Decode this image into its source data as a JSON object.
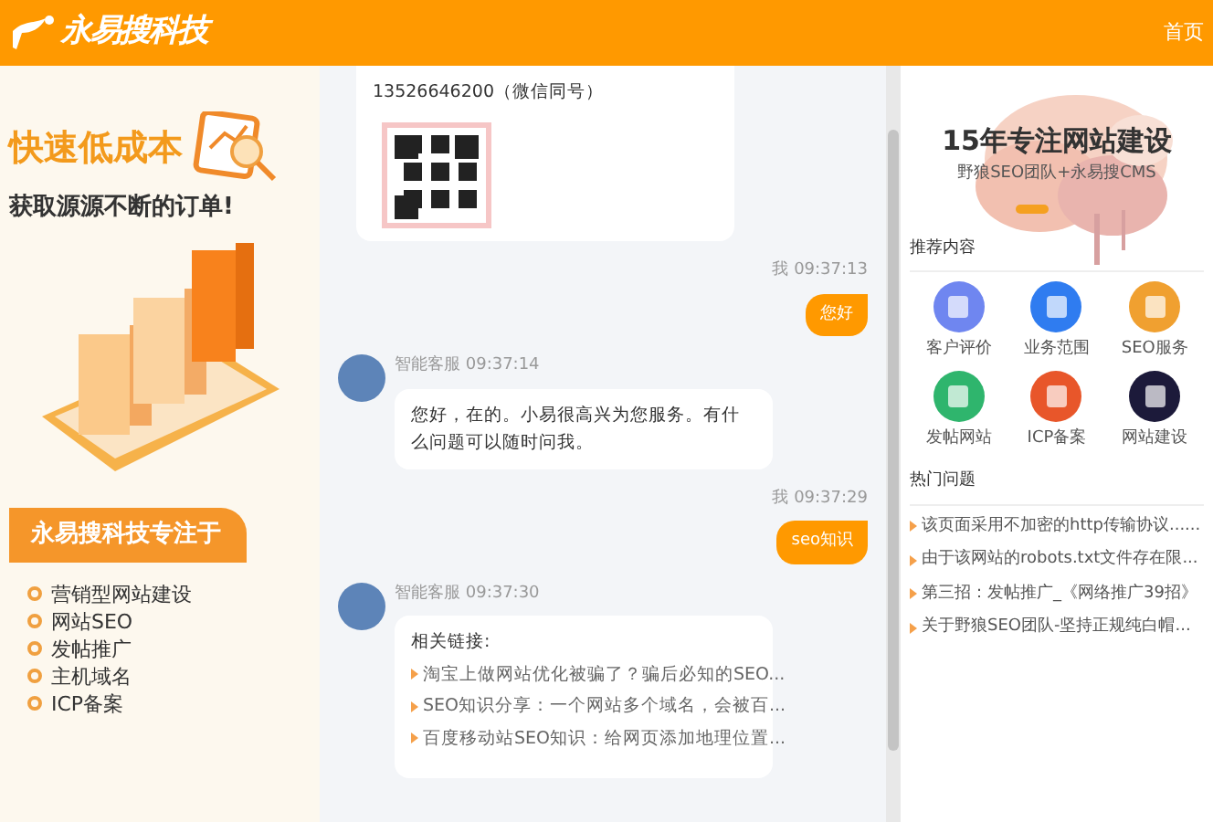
{
  "header": {
    "logo": "永易搜科技",
    "nav_link": "首页"
  },
  "promo": {
    "headline": "快速低成本",
    "subline": "获取源源不断的订单!",
    "section_title": "永易搜科技专注于",
    "services": [
      "营销型网站建设",
      "网站SEO",
      "发帖推广",
      "主机域名",
      "ICP备案"
    ]
  },
  "chat": [
    {
      "kind": "bot_qr",
      "text": "13526646200（微信同号）"
    },
    {
      "kind": "user",
      "meta": "我 09:37:13",
      "text": "您好"
    },
    {
      "kind": "bot",
      "meta": "智能客服 09:37:14",
      "text": "您好，在的。小易很高兴为您服务。有什么问题可以随时问我。"
    },
    {
      "kind": "user",
      "meta": "我 09:37:29",
      "text": "seo知识"
    },
    {
      "kind": "bot_links",
      "meta": "智能客服 09:37:30",
      "text": "相关链接:",
      "links": [
        "淘宝上做网站优化被骗了？骗后必知的SEO...",
        "SEO知识分享：一个网站多个域名，会被百...",
        "百度移动站SEO知识：给网页添加地理位置..."
      ]
    }
  ],
  "banner": {
    "title": "15年专注网站建设",
    "subtitle": "野狼SEO团队+永易搜CMS"
  },
  "recommended": {
    "title": "推荐内容",
    "items": [
      {
        "label": "客户评价",
        "color": "#6f86f0"
      },
      {
        "label": "业务范围",
        "color": "#2f7cf0"
      },
      {
        "label": "SEO服务",
        "color": "#f0a030"
      },
      {
        "label": "发帖网站",
        "color": "#2fb56d"
      },
      {
        "label": "ICP备案",
        "color": "#e8562a"
      },
      {
        "label": "网站建设",
        "color": "#1c1a3a"
      }
    ]
  },
  "hot": {
    "title": "热门问题",
    "items": [
      "该页面采用不加密的http传输协议......",
      "由于该网站的robots.txt文件存在限...",
      "第三招：发帖推广_《网络推广39招》",
      "关于野狼SEO团队-坚持正规纯白帽..."
    ]
  }
}
